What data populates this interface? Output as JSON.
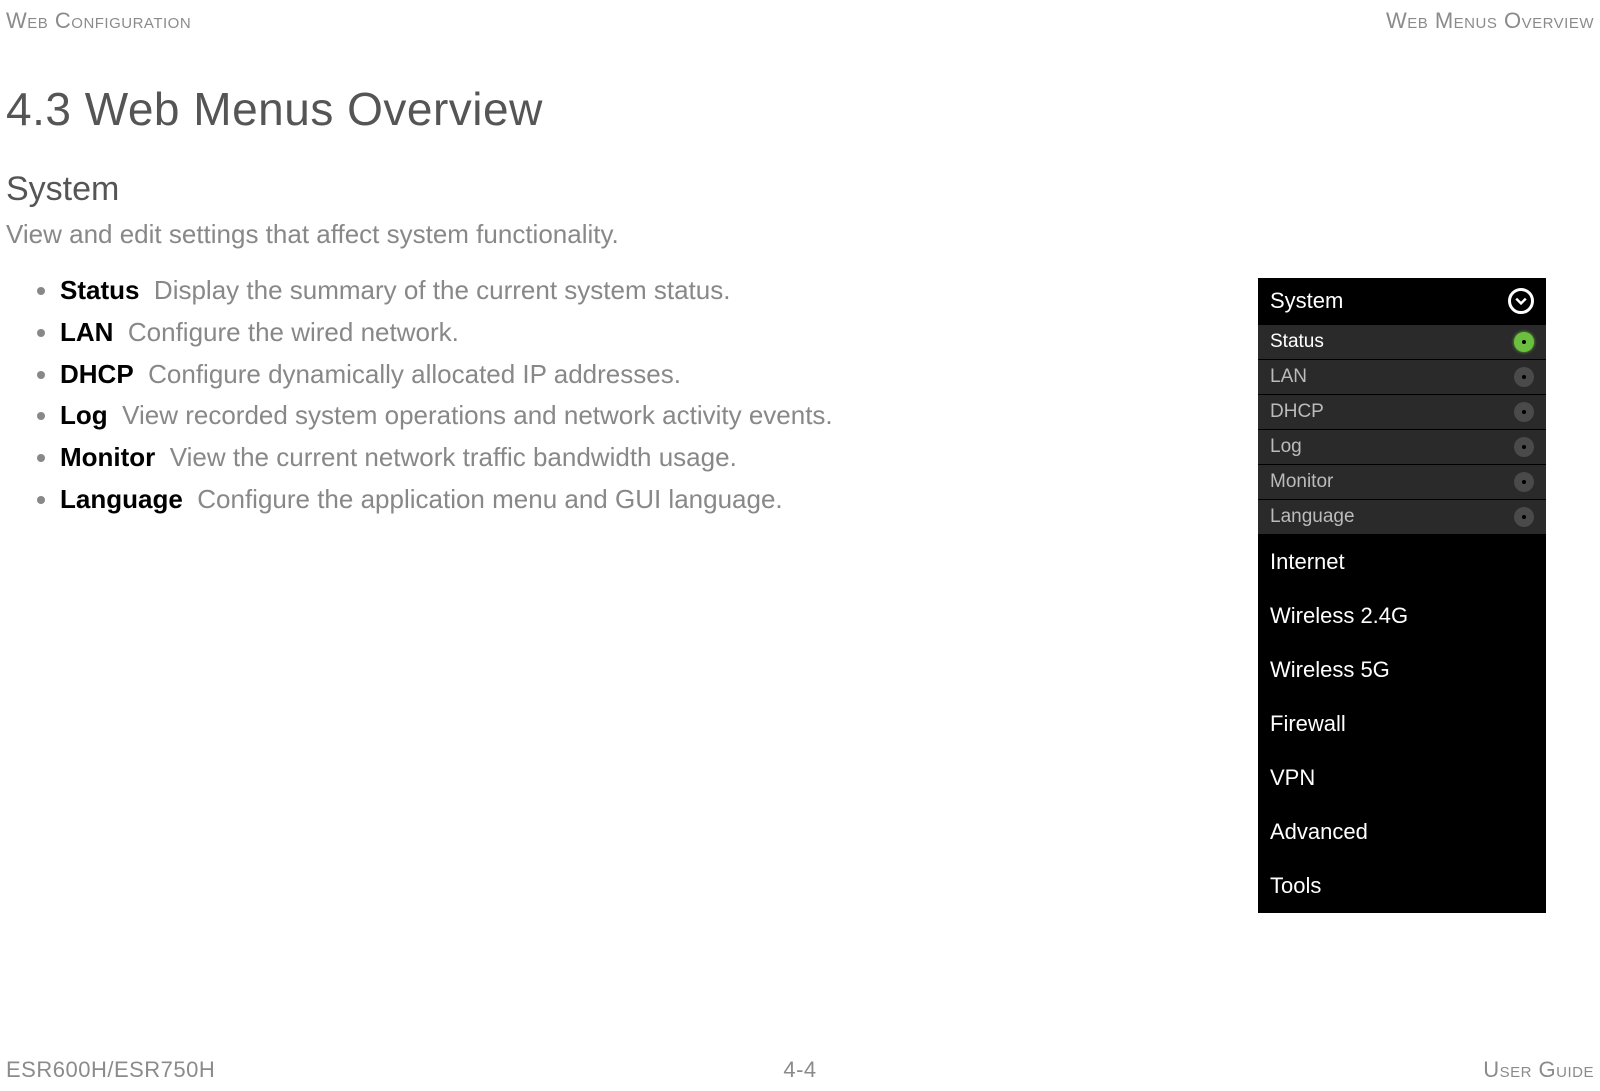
{
  "header": {
    "left": "Web Configuration",
    "right": "Web Menus Overview"
  },
  "main_title": "4.3 Web Menus Overview",
  "subsection": {
    "title": "System",
    "desc": "View and edit settings that affect system functionality.",
    "items": [
      {
        "name": "Status",
        "desc": "Display the summary of the current system status."
      },
      {
        "name": "LAN",
        "desc": "Configure the wired network."
      },
      {
        "name": "DHCP",
        "desc": "Configure dynamically allocated IP addresses."
      },
      {
        "name": "Log",
        "desc": "View recorded system operations and network activity events."
      },
      {
        "name": "Monitor",
        "desc": "View the current network traffic bandwidth usage."
      },
      {
        "name": "Language",
        "desc": "Configure the application menu and GUI language."
      }
    ]
  },
  "menu": {
    "expanded_section": "System",
    "subitems": [
      {
        "label": "Status",
        "active": true
      },
      {
        "label": "LAN",
        "active": false
      },
      {
        "label": "DHCP",
        "active": false
      },
      {
        "label": "Log",
        "active": false
      },
      {
        "label": "Monitor",
        "active": false
      },
      {
        "label": "Language",
        "active": false
      }
    ],
    "sections": [
      "Internet",
      "Wireless 2.4G",
      "Wireless 5G",
      "Firewall",
      "VPN",
      "Advanced",
      "Tools"
    ]
  },
  "footer": {
    "left": "ESR600H/ESR750H",
    "center": "4-4",
    "right": "User Guide"
  }
}
